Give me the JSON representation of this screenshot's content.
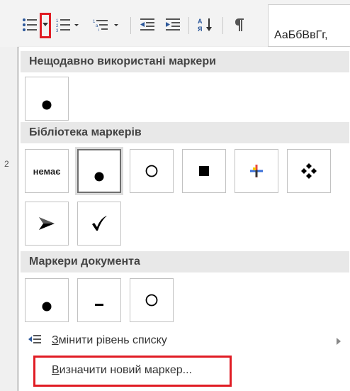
{
  "ribbon": {
    "styles_preview": "АаБбВвГг,",
    "icons": [
      "bullets-icon",
      "bullets-dropdown-icon",
      "numbering-icon",
      "multilevel-list-icon",
      "decrease-indent-icon",
      "increase-indent-icon",
      "sort-icon",
      "show-formatting-marks-icon"
    ]
  },
  "left_margin_number": "2",
  "panel": {
    "recent_title": "Нещодавно використані маркери",
    "library_title": "Бібліотека маркерів",
    "none_label": "немає",
    "document_title": "Маркери документа",
    "change_level_label_prefix": "З",
    "change_level_label_rest": "мінити рівень списку",
    "define_new_label_prefix": "В",
    "define_new_label_rest": "изначити новий маркер..."
  },
  "colors": {
    "highlight_red": "#e01c24",
    "section_bg": "#e8e8e8",
    "ribbon_bg": "#f3f3f3"
  }
}
